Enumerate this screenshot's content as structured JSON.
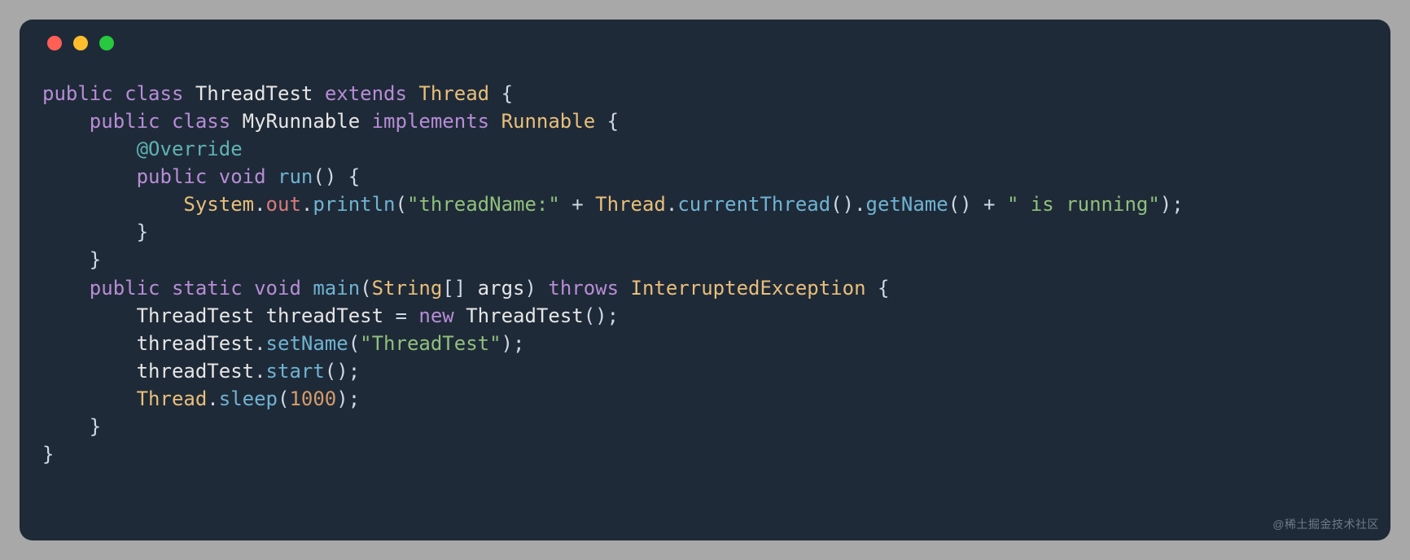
{
  "watermark": "@稀土掘金技术社区",
  "code": {
    "tokens": {
      "kw_public": "public",
      "kw_class": "class",
      "kw_extends": "extends",
      "kw_implements": "implements",
      "kw_void": "void",
      "kw_static": "static",
      "kw_new": "new",
      "kw_throws": "throws",
      "ann_override": "@Override",
      "ty_Thread": "Thread",
      "ty_Runnable": "Runnable",
      "ty_System": "System",
      "ty_String": "String",
      "ty_IEx": "InterruptedException",
      "nm_ThreadTest": "ThreadTest",
      "nm_MyRunnable": "MyRunnable",
      "nm_threadTest": "threadTest",
      "nm_args": "args",
      "fd_out": "out",
      "fn_run": "run",
      "fn_println": "println",
      "fn_currentThread": "currentThread",
      "fn_getName": "getName",
      "fn_main": "main",
      "fn_setName": "setName",
      "fn_start": "start",
      "fn_sleep": "sleep",
      "str_threadName": "\"threadName:\"",
      "str_isRunning": "\" is running\"",
      "str_ThreadTest": "\"ThreadTest\"",
      "num_1000": "1000",
      "p_lbrace": "{",
      "p_rbrace": "}",
      "p_lparen": "(",
      "p_rparen": ")",
      "p_lbrack": "[",
      "p_rbrack": "]",
      "p_semi": ";",
      "p_dot": ".",
      "p_plus": "+",
      "p_eq": "=",
      "p_sp": " "
    }
  }
}
